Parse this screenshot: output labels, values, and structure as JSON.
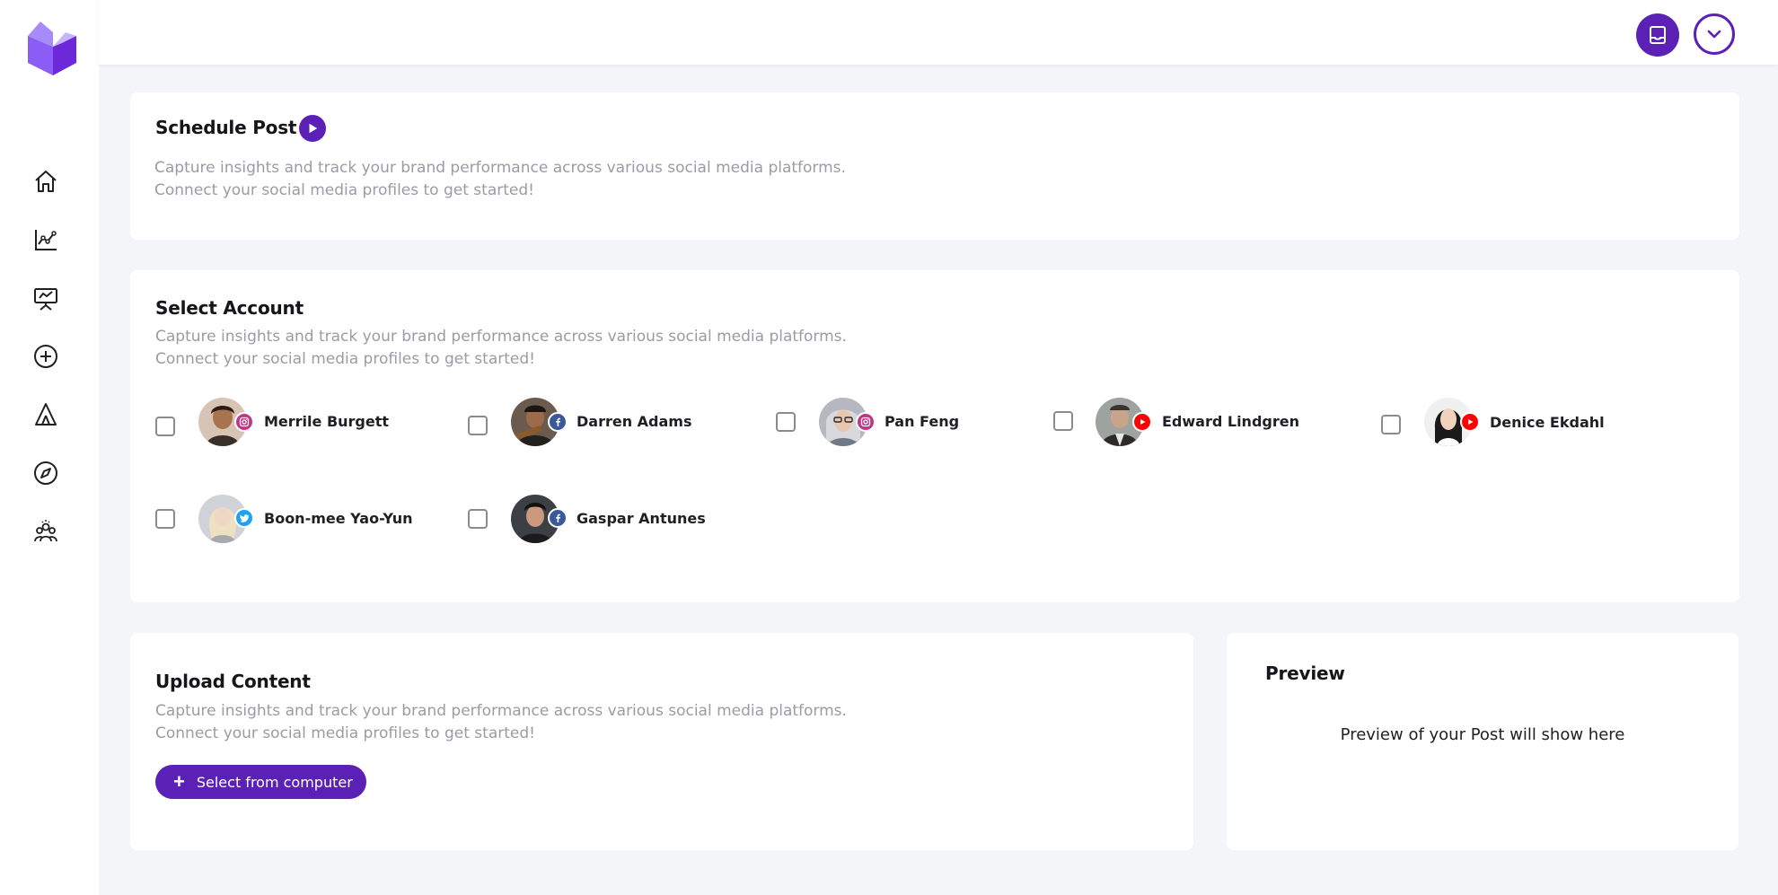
{
  "brand": {
    "accent": "#5b21b6",
    "logo_icon": "cube-logo-icon"
  },
  "sidebar": {
    "items": [
      {
        "name": "home",
        "icon": "home-icon"
      },
      {
        "name": "analytics",
        "icon": "line-chart-icon"
      },
      {
        "name": "presentation",
        "icon": "presentation-board-icon"
      },
      {
        "name": "create",
        "icon": "plus-circle-icon"
      },
      {
        "name": "campaigns",
        "icon": "tent-icon"
      },
      {
        "name": "explore",
        "icon": "compass-icon"
      },
      {
        "name": "team",
        "icon": "team-icon"
      }
    ]
  },
  "header": {
    "buttons": [
      {
        "name": "inbox",
        "icon": "inbox-icon"
      },
      {
        "name": "account-menu",
        "icon": "chevron-down-icon"
      }
    ]
  },
  "schedule": {
    "title": "Schedule Post",
    "desc_line1": "Capture insights and track your brand performance across various social media platforms.",
    "desc_line2": "Connect your social media profiles to get started!"
  },
  "select_account": {
    "title": "Select Account",
    "desc_line1": "Capture insights and track your brand performance across various social media platforms.",
    "desc_line2": "Connect your social media profiles to get started!",
    "accounts": [
      {
        "name": "Merrile Burgett",
        "network": "instagram",
        "checked": false
      },
      {
        "name": "Darren Adams",
        "network": "facebook",
        "checked": false
      },
      {
        "name": "Pan Feng",
        "network": "instagram",
        "checked": false
      },
      {
        "name": "Edward Lindgren",
        "network": "youtube",
        "checked": false
      },
      {
        "name": "Denice Ekdahl",
        "network": "youtube",
        "checked": false
      },
      {
        "name": "Boon-mee Yao-Yun",
        "network": "twitter",
        "checked": false
      },
      {
        "name": "Gaspar Antunes",
        "network": "facebook",
        "checked": false
      }
    ]
  },
  "upload": {
    "title": "Upload Content",
    "desc_line1": "Capture insights and track your brand performance across various social media platforms.",
    "desc_line2": "Connect your social media profiles to get started!",
    "button_label": "Select from computer",
    "button_icon": "plus-icon"
  },
  "preview": {
    "title": "Preview",
    "placeholder": "Preview of your Post will show here"
  }
}
